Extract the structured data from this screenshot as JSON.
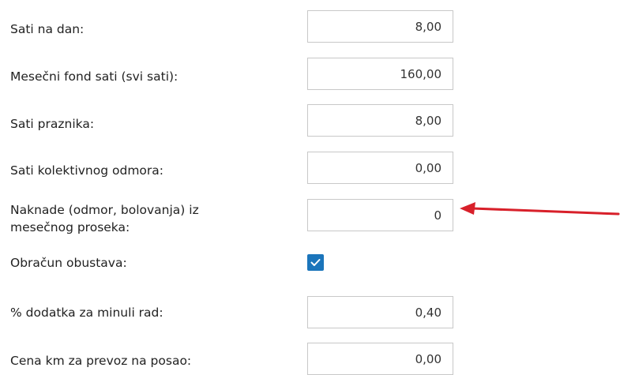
{
  "colors": {
    "accent": "#1b75bb",
    "arrow": "#d8202a",
    "border": "#c8c8c8",
    "text": "#222222"
  },
  "form": {
    "sati_na_dan": {
      "label": "Sati na dan:",
      "value": "8,00"
    },
    "mesecni_fond": {
      "label": "Mesečni fond sati (svi sati):",
      "value": "160,00"
    },
    "sati_praznika": {
      "label": "Sati praznika:",
      "value": "8,00"
    },
    "sati_kolektivnog": {
      "label": "Sati kolektivnog odmora:",
      "value": "0,00"
    },
    "naknade": {
      "label_line1": "Naknade (odmor, bolovanja) iz",
      "label_line2": "mesečnog proseka:",
      "value": "0"
    },
    "obracun_obustava": {
      "label": "Obračun obustava:",
      "checked": true,
      "icon": "checkmark-icon"
    },
    "minuli_rad": {
      "label": "% dodatka za minuli rad:",
      "value": "0,40"
    },
    "cena_km": {
      "label": "Cena km za prevoz na posao:",
      "value": "0,00"
    }
  },
  "annotation": {
    "icon": "arrow-left-icon"
  }
}
